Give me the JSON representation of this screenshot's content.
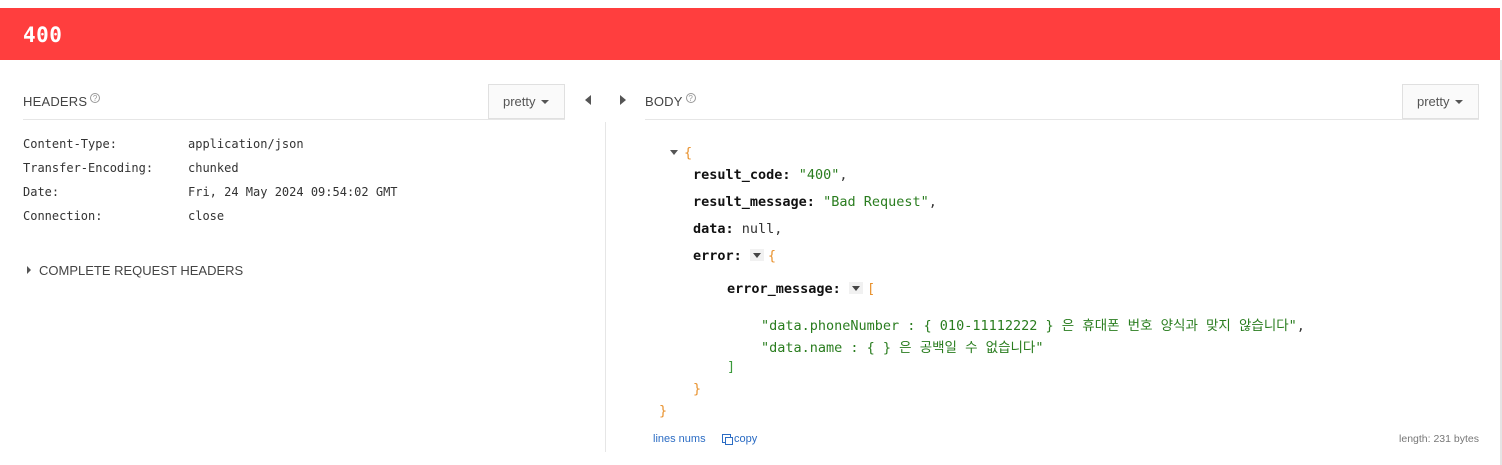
{
  "status": {
    "code": "400",
    "color": "#ff3e3e"
  },
  "headers_pane": {
    "title": "HEADERS",
    "help_glyph": "?",
    "format_label": "pretty",
    "rows": [
      {
        "name": "Content-Type:",
        "value": "application/json"
      },
      {
        "name": "Transfer-Encoding:",
        "value": "chunked"
      },
      {
        "name": "Date:",
        "value": "Fri, 24 May 2024 09:54:02 GMT"
      },
      {
        "name": "Connection:",
        "value": "close"
      }
    ],
    "complete_request_label": "COMPLETE REQUEST HEADERS"
  },
  "body_pane": {
    "title": "BODY",
    "help_glyph": "?",
    "format_label": "pretty",
    "json": {
      "open_brace": "{",
      "close_brace": "}",
      "result_code_key": "result_code:",
      "result_code_value": "\"400\"",
      "result_message_key": "result_message:",
      "result_message_value": "\"Bad Request\"",
      "data_key": "data:",
      "data_value": "null",
      "error_key": "error:",
      "error_open": "{",
      "error_close": "}",
      "error_message_key": "error_message:",
      "array_open": "[",
      "array_close": "]",
      "messages": [
        "\"data.phoneNumber : { 010-11112222 } 은 휴대폰 번호 양식과 맞지 않습니다\"",
        "\"data.name : {  } 은 공백일 수 없습니다\""
      ],
      "comma": ","
    },
    "footer": {
      "line_nums_label": "lines nums",
      "copy_label": "copy",
      "length_label": "length: 231 bytes"
    }
  }
}
